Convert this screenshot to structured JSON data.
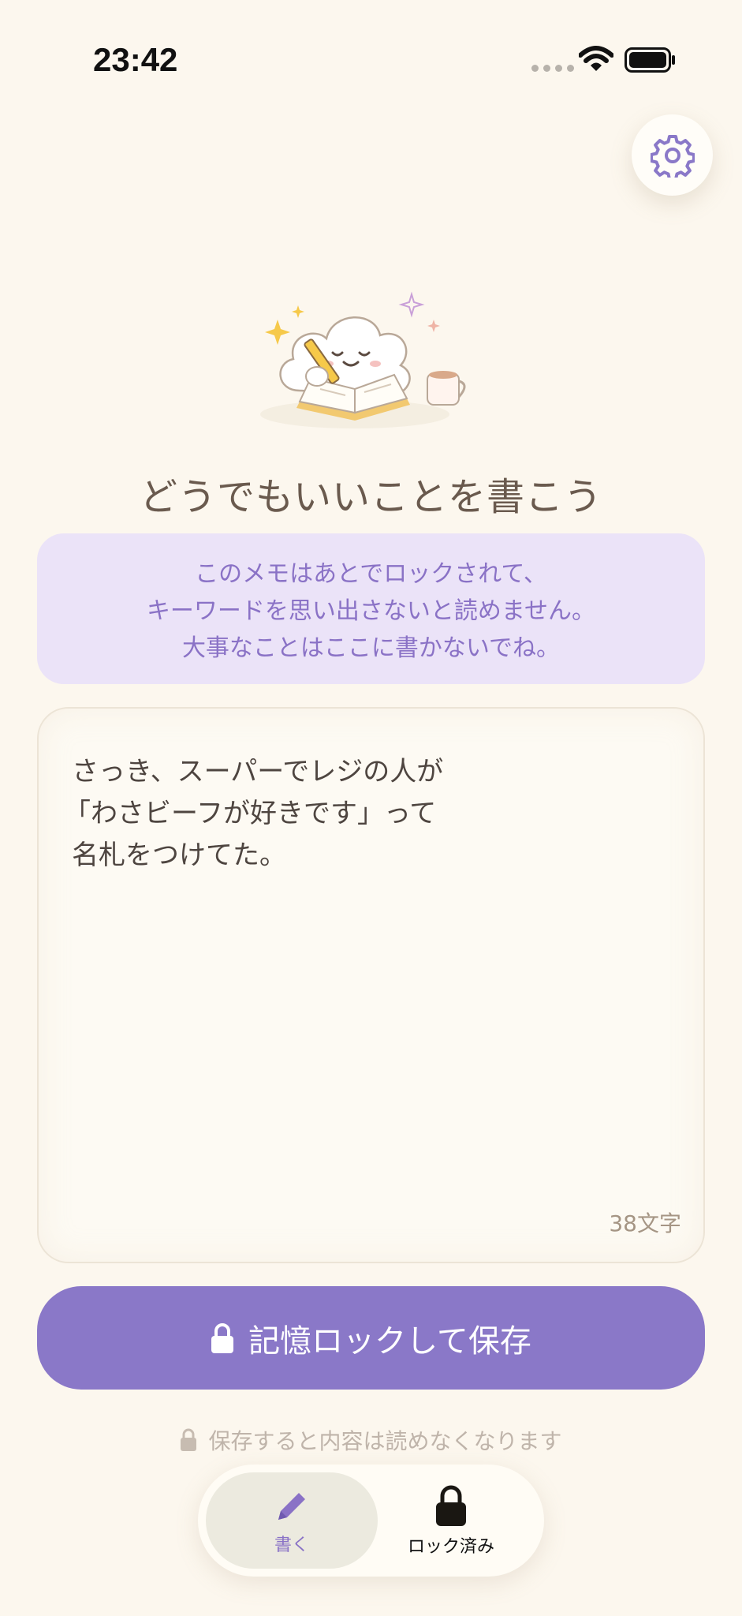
{
  "status_bar": {
    "time": "23:42",
    "signal_icon": "cellular-dots-icon",
    "wifi_icon": "wifi-icon",
    "battery_icon": "battery-icon"
  },
  "settings": {
    "icon": "gear-icon"
  },
  "hero": {
    "icon": "cloud-writing-illustration"
  },
  "headline": "どうでもいいことを書こう",
  "notice": {
    "lines": [
      "このメモはあとでロックされて、",
      "キーワードを思い出さないと読めません。",
      "大事なことはここに書かないでね。"
    ]
  },
  "editor": {
    "lines": [
      "さっき、スーパーでレジの人が",
      "「わさビーフが好きです」って",
      "名札をつけてた。"
    ],
    "char_count": "38文字"
  },
  "save_button": {
    "label": "記憶ロックして保存",
    "icon": "lock-icon"
  },
  "hint": {
    "text": "保存すると内容は読めなくなります",
    "icon": "lock-icon"
  },
  "tabs": [
    {
      "label": "書く",
      "icon": "pencil-icon",
      "active": true
    },
    {
      "label": "ロック済み",
      "icon": "lock-icon",
      "active": false
    }
  ],
  "colors": {
    "background": "#fcf7ee",
    "accent": "#8a78c8",
    "notice_bg": "#ebe3f8",
    "notice_text": "#8a72c6",
    "text": "#5f5148"
  }
}
